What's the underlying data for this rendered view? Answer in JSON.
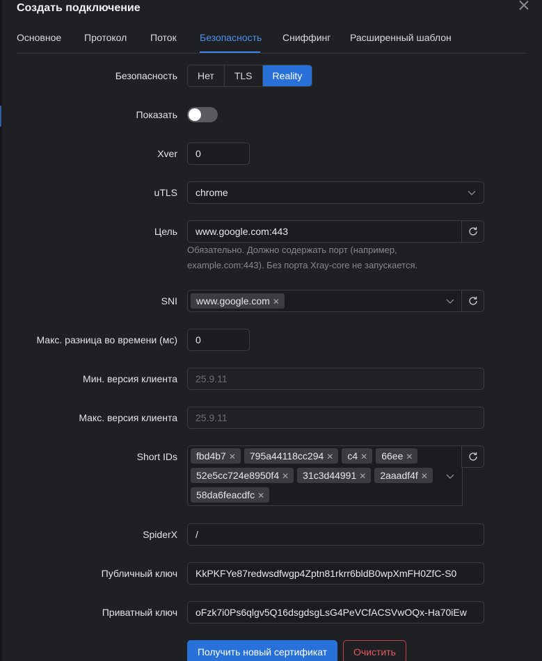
{
  "modal": {
    "title": "Создать подключение"
  },
  "tabs": [
    {
      "label": "Основное"
    },
    {
      "label": "Протокол"
    },
    {
      "label": "Поток"
    },
    {
      "label": "Безопасность"
    },
    {
      "label": "Сниффинг"
    },
    {
      "label": "Расширенный шаблон"
    }
  ],
  "active_tab": "Безопасность",
  "security": {
    "label": "Безопасность",
    "options": [
      "Нет",
      "TLS",
      "Reality"
    ],
    "selected": "Reality"
  },
  "show": {
    "label": "Показать",
    "enabled": false
  },
  "xver": {
    "label": "Xver",
    "value": "0"
  },
  "utls": {
    "label": "uTLS",
    "value": "chrome"
  },
  "target": {
    "label": "Цель",
    "value": "www.google.com:443",
    "hint_line1": "Обязательно. Должно содержать порт (например,",
    "hint_line2": "example.com:443). Без порта Xray-core не запускается."
  },
  "sni": {
    "label": "SNI",
    "tags": [
      "www.google.com"
    ]
  },
  "max_time_diff": {
    "label": "Макс. разница во времени (мс)",
    "value": "0"
  },
  "min_client_ver": {
    "label": "Мин. версия клиента",
    "placeholder": "25.9.11"
  },
  "max_client_ver": {
    "label": "Макс. версия клиента",
    "placeholder": "25.9.11"
  },
  "short_ids": {
    "label": "Short IDs",
    "rows": [
      [
        "fbd4b7",
        "795a44118cc294",
        "c4",
        "66ee"
      ],
      [
        "52e5cc724e8950f4",
        "31c3d44991",
        "2aaadf4f"
      ],
      [
        "58da6feacdfc"
      ]
    ]
  },
  "spiderx": {
    "label": "SpiderX",
    "value": "/"
  },
  "public_key": {
    "label": "Публичный ключ",
    "value": "KkPKFYe87redwsdfwgp4Zptn81rkrr6bldB0wpXmFH0ZfC-S0"
  },
  "private_key": {
    "label": "Приватный ключ",
    "value": "oFzk7i0Ps6qlgv5Q16dsgdsgLsG4PeVCfACSVwOQx-Ha70iEw"
  },
  "buttons": {
    "get_cert": "Получить новый сертификат",
    "clear": "Очистить"
  },
  "icons": {
    "close": "close-icon",
    "refresh": "refresh-icon",
    "chevron": "chevron-down-icon",
    "tag_remove": "close-small-icon"
  },
  "colors": {
    "accent": "#2771d8",
    "danger": "#e35a60",
    "background": "#1f2024"
  }
}
